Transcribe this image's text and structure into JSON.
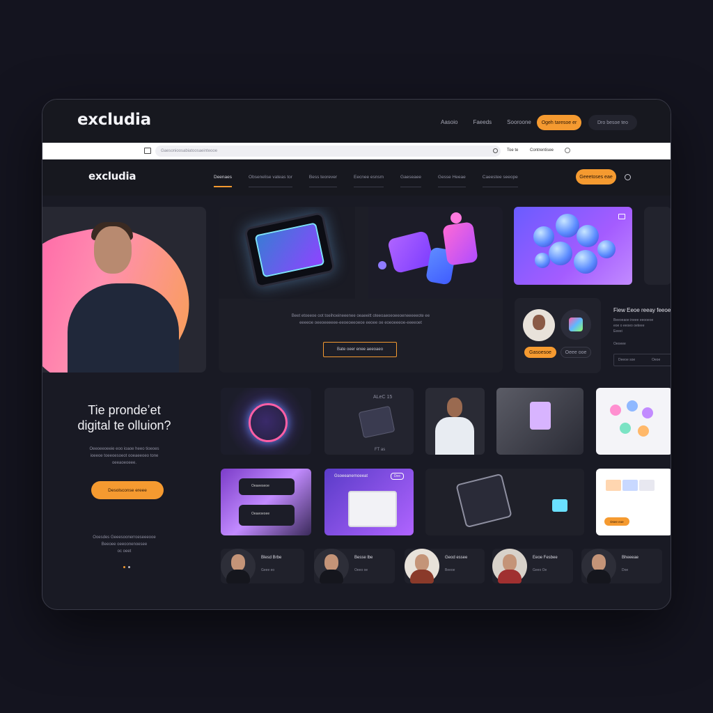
{
  "brand": {
    "name": "excludia",
    "accent": "#f59a30"
  },
  "top_nav": {
    "links": [
      "Aasoio",
      "Faeeds",
      "Sooroone"
    ],
    "primary_button": "Ogeh taresoe er",
    "secondary_button": "Dro besoe teo"
  },
  "browser": {
    "url": "Gaesonioosabiatoosaeinteooe",
    "action_label": "Toe te",
    "extra_label": "Contrentisee"
  },
  "main_nav": {
    "items": [
      "Deenaes",
      "Obsenelise vateas tor",
      "Bess teorever",
      "Eecnee esnsm",
      "Gaeseaee",
      "Gesse Heeae",
      "Caeestee seeope"
    ],
    "button": "Geeetoses eae"
  },
  "hero": {
    "headline_line1": "Tie prondeʼet",
    "headline_line2": "digital te olluion?",
    "paragraph": "Oeeoeeoeeie eoo ioaoe heeo tioeoes\nioeeoe toeeoesoeot ooeaeeoeo tone\noeeaoeoeee.",
    "cta": "Desolsconse ereee",
    "footer_text": "Ooesdes  Geeesoonerroeseeeooe\nBeeoee oeeoonenoesee\noc oeet"
  },
  "feature": {
    "text": "Beet etoeeoe oot toeihoeineeenee oeaeeitt oteeoaeoeoeeoeneeeeeote ee\neeeeoe oeeoeeeeee-eeoeoeeoeoe eeoee oe eoeoeeeoe-eeeeoet",
    "button": "Bate oeer enee aeeoaeo"
  },
  "side": {
    "title": "Fiew Eeoe reeay feeoe",
    "lines": [
      "Beeoeaoe ineee  eeooeoe",
      "eoe o eeoeo oeteee",
      "Eeeei"
    ],
    "link": "Oeoeee",
    "btn1": "Gasoesoe",
    "btn2": "Oeee ooe",
    "btn3": "Deeoe soe",
    "btn4": "Oeoe"
  },
  "grid": {
    "tile2_label": "ALeC 15",
    "tile2_sub": "FT as",
    "card1_a": "Oeaeeseoe",
    "card1_b": "Oeaeoeoee",
    "tile6_tag": "Dee",
    "tile6_title": "Gsoeeanernoeeat",
    "tile10_btn": "Dsee eoe"
  },
  "people": [
    {
      "name": "Blesd Brbe",
      "role": "Geee eo"
    },
    {
      "name": "Besse lbe",
      "role": "Oeeo oe"
    },
    {
      "name": "Geod essee",
      "role": "Beeoe"
    },
    {
      "name": "Eeoe Fesbee",
      "role": "Geeo Oe"
    },
    {
      "name": "Bheeeae",
      "role": "Doe"
    }
  ]
}
